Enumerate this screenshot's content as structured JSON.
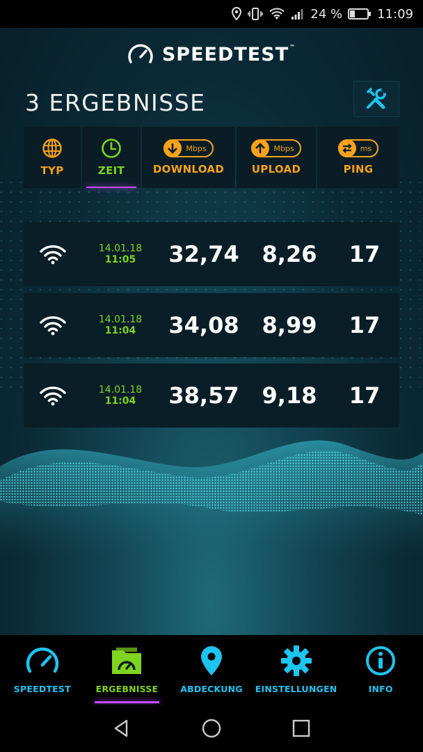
{
  "status_bar": {
    "battery": "24 %",
    "time": "11:09"
  },
  "app": {
    "logo": "SPEEDTEST",
    "logo_tm": "™"
  },
  "page": {
    "title": "3 ERGEBNISSE"
  },
  "header": {
    "typ": "TYP",
    "zeit": "ZEIT",
    "download": "DOWNLOAD",
    "download_unit": "Mbps",
    "upload": "UPLOAD",
    "upload_unit": "Mbps",
    "ping": "PING",
    "ping_unit": "ms"
  },
  "results": [
    {
      "type_icon": "wifi-icon",
      "date": "14.01.18",
      "time": "11:05",
      "download": "32,74",
      "upload": "8,26",
      "ping": "17"
    },
    {
      "type_icon": "wifi-icon",
      "date": "14.01.18",
      "time": "11:04",
      "download": "34,08",
      "upload": "8,99",
      "ping": "17"
    },
    {
      "type_icon": "wifi-icon",
      "date": "14.01.18",
      "time": "11:04",
      "download": "38,57",
      "upload": "9,18",
      "ping": "17"
    }
  ],
  "nav": {
    "items": [
      {
        "label": "SPEEDTEST",
        "icon": "speedometer-icon"
      },
      {
        "label": "ERGEBNISSE",
        "icon": "results-folder-icon"
      },
      {
        "label": "ABDECKUNG",
        "icon": "map-pin-icon"
      },
      {
        "label": "EINSTELLUNGEN",
        "icon": "gear-icon"
      },
      {
        "label": "INFO",
        "icon": "info-icon"
      }
    ]
  },
  "colors": {
    "accent_orange": "#f7a21b",
    "accent_green": "#7fd41f",
    "accent_cyan": "#1ec4f0",
    "accent_purple": "#c24cff"
  }
}
